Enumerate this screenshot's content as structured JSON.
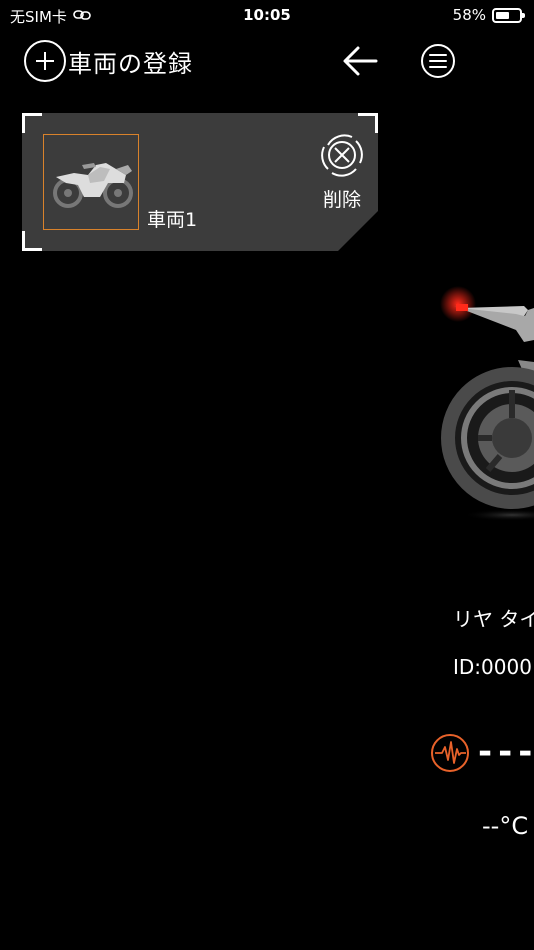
{
  "status_bar": {
    "carrier": "无SIM卡",
    "link_icon": "link-icon",
    "time": "10:05",
    "battery_percent": "58%",
    "battery_level": 0.58
  },
  "header": {
    "register_label": "車両の登録",
    "back_icon": "arrow-left-icon",
    "menu_icon": "menu-icon"
  },
  "vehicle_card": {
    "name": "車両1",
    "delete_label": "削除",
    "accent_color": "#d9822b",
    "card_color": "#3c3c3c"
  },
  "tire_panel": {
    "label": "リヤ タイ",
    "id_text": "ID:0000",
    "pressure": "---",
    "temperature": "--°C",
    "pulse_color": "#e8622a",
    "tail_light_color": "#ff2a1a"
  }
}
